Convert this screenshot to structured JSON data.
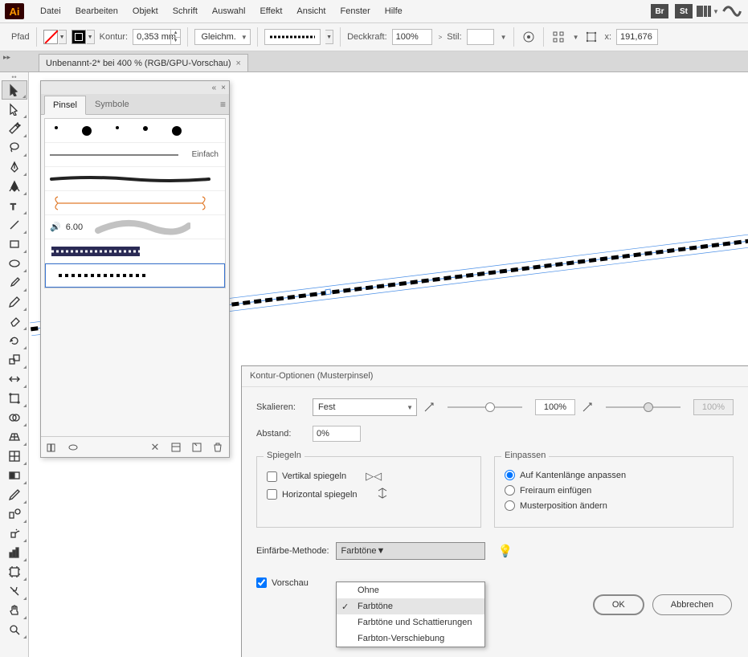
{
  "app": {
    "logo": "Ai"
  },
  "menu": [
    "Datei",
    "Bearbeiten",
    "Objekt",
    "Schrift",
    "Auswahl",
    "Effekt",
    "Ansicht",
    "Fenster",
    "Hilfe"
  ],
  "topbadges": {
    "br": "Br",
    "st": "St"
  },
  "optbar": {
    "pfad": "Pfad",
    "kontur": "Kontur:",
    "stroke_val": "0,353 mm",
    "profile": "Gleichm.",
    "deckkraft_lbl": "Deckkraft:",
    "deckkraft_val": "100%",
    "stil_lbl": "Stil:",
    "x_lbl": "x:",
    "x_val": "191,676"
  },
  "doc_tab": {
    "title": "Unbenannt-2* bei 400 % (RGB/GPU-Vorschau)",
    "close": "×"
  },
  "pinsel": {
    "tab1": "Pinsel",
    "tab2": "Symbole",
    "einfach": "Einfach",
    "sixpt": "6.00"
  },
  "dialog": {
    "title": "Kontur-Optionen (Musterpinsel)",
    "skalieren": "Skalieren:",
    "skalieren_val": "Fest",
    "slider_val": "100%",
    "slider_val2": "100%",
    "abstand": "Abstand:",
    "abstand_val": "0%",
    "spiegeln": "Spiegeln",
    "vert": "Vertikal spiegeln",
    "horiz": "Horizontal spiegeln",
    "einpassen": "Einpassen",
    "fit1": "Auf Kantenlänge anpassen",
    "fit2": "Freiraum einfügen",
    "fit3": "Musterposition ändern",
    "method_lbl": "Einfärbe-Methode:",
    "method_val": "Farbtöne",
    "vorschau": "Vorschau",
    "ok": "OK",
    "cancel": "Abbrechen",
    "menu": {
      "ohne": "Ohne",
      "farbtone": "Farbtöne",
      "fsch": "Farbtöne und Schattierungen",
      "fver": "Farbton-Verschiebung"
    }
  }
}
